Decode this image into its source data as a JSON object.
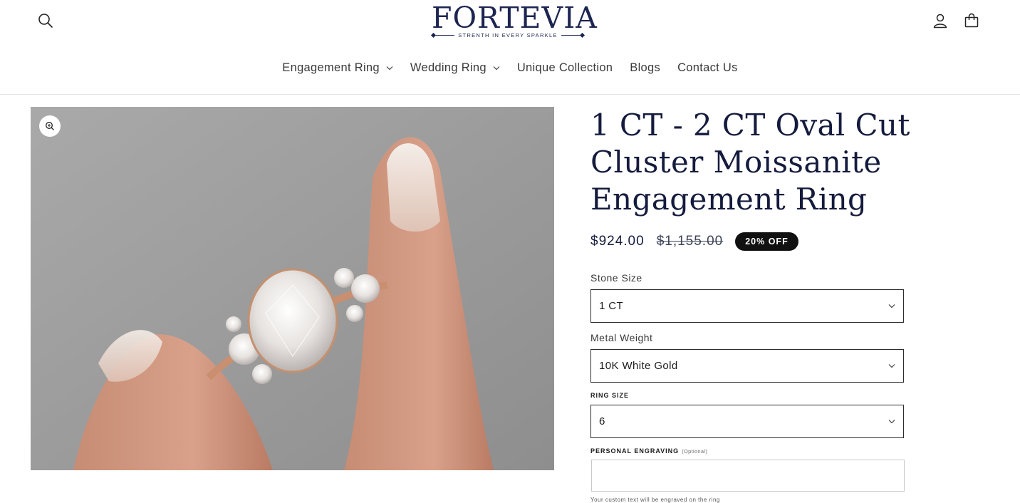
{
  "brand": {
    "name": "FORTEVIA",
    "tagline": "STRENTH IN EVERY SPARKLE"
  },
  "icons": {
    "search": "search-icon",
    "account": "user-icon",
    "cart": "cart-icon",
    "zoom": "zoom-in-icon",
    "dropdown": "chevron-down-icon"
  },
  "nav": {
    "items": [
      {
        "label": "Engagement Ring",
        "has_dropdown": true
      },
      {
        "label": "Wedding Ring",
        "has_dropdown": true
      },
      {
        "label": "Unique Collection",
        "has_dropdown": false
      },
      {
        "label": "Blogs",
        "has_dropdown": false
      },
      {
        "label": "Contact Us",
        "has_dropdown": false
      }
    ]
  },
  "product": {
    "title": "1 CT - 2 CT Oval Cut Cluster Moissanite Engagement Ring",
    "sale_price": "$924.00",
    "regular_price": "$1,155.00",
    "badge": "20% OFF",
    "image_description": "Oval cut moissanite cluster ring in rose gold held between fingers"
  },
  "options": {
    "stone_size": {
      "label": "Stone Size",
      "value": "1 CT"
    },
    "metal_weight": {
      "label": "Metal Weight",
      "value": "10K White Gold"
    },
    "ring_size": {
      "label": "RING SIZE",
      "value": "6"
    },
    "engraving": {
      "label": "PERSONAL ENGRAVING",
      "optional": "(Optional)",
      "value": "",
      "hint": "Your custom text will be engraved on the ring"
    }
  },
  "colors": {
    "navy": "#151b3d",
    "badge_bg": "#111111",
    "background": "#ffffff"
  }
}
